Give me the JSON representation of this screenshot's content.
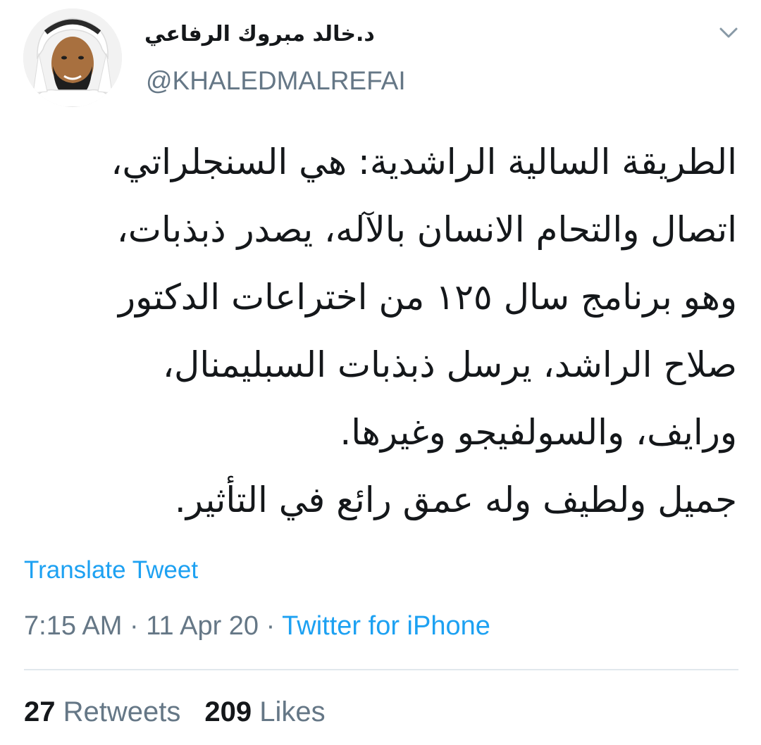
{
  "author": {
    "display_name": "د.خالد مبروك الرفاعي",
    "handle": "@KHALEDMALREFAI",
    "avatar_icon": "user-avatar-photo"
  },
  "tweet": {
    "lines": [
      "الطريقة السالية الراشدية: هي السنجلراتي،",
      "اتصال والتحام الانسان بالآله، يصدر ذبذبات،",
      "وهو برنامج سال ١٢٥ من اختراعات الدكتور",
      "صلاح الراشد، يرسل ذبذبات السبليمنال،",
      "ورايف، والسولفيجو وغيرها.",
      "جميل ولطيف وله عمق رائع في التأثير."
    ],
    "translate_label": "Translate Tweet",
    "time": "7:15 AM",
    "separator": "·",
    "date": "11 Apr 20",
    "source": "Twitter for iPhone"
  },
  "stats": {
    "retweets_count": "27",
    "retweets_label": "Retweets",
    "likes_count": "209",
    "likes_label": "Likes"
  },
  "colors": {
    "link": "#1da1f2",
    "secondary_text": "#657786",
    "primary_text": "#14171a",
    "divider": "#e1e8ed"
  },
  "icons": {
    "menu": "chevron-down-icon"
  }
}
